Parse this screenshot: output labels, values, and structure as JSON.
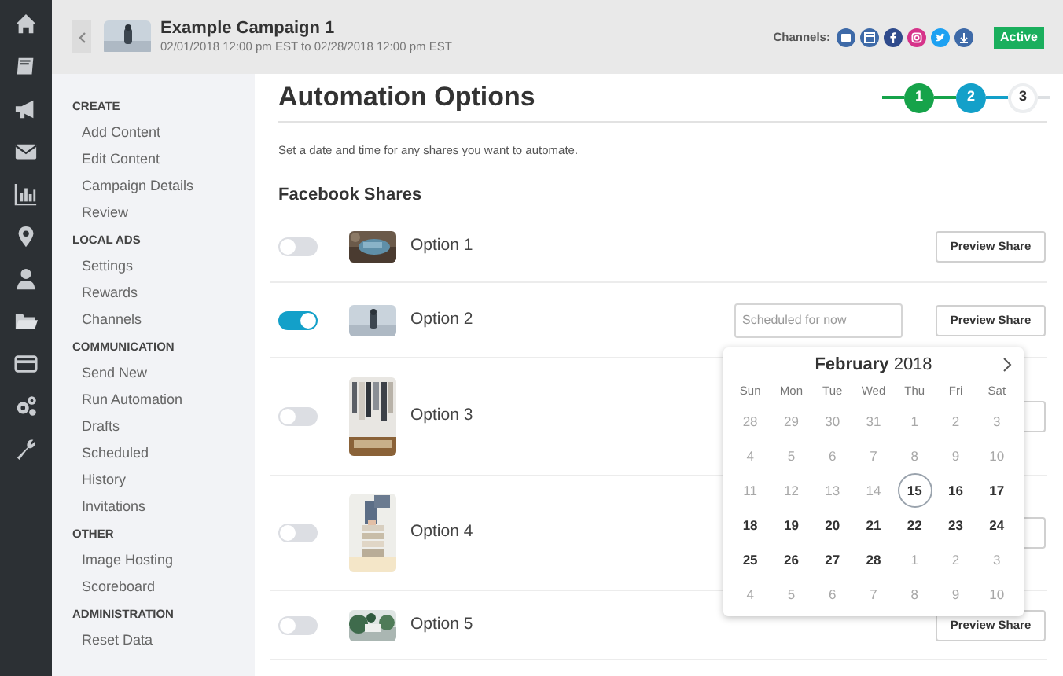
{
  "header": {
    "title": "Example Campaign 1",
    "dates": "02/01/2018 12:00 pm EST to 02/28/2018 12:00 pm EST",
    "channels_label": "Channels:",
    "status": "Active"
  },
  "sidebar": [
    {
      "heading": "CREATE",
      "items": [
        "Add Content",
        "Edit Content",
        "Campaign Details",
        "Review"
      ]
    },
    {
      "heading": "LOCAL ADS",
      "items": [
        "Settings",
        "Rewards",
        "Channels"
      ]
    },
    {
      "heading": "COMMUNICATION",
      "items": [
        "Send New",
        "Run Automation",
        "Drafts",
        "Scheduled",
        "History",
        "Invitations"
      ]
    },
    {
      "heading": "OTHER",
      "items": [
        "Image Hosting",
        "Scoreboard"
      ]
    },
    {
      "heading": "ADMINISTRATION",
      "items": [
        "Reset Data"
      ]
    }
  ],
  "page": {
    "title": "Automation Options",
    "description": "Set a date and time for any shares you want to automate.",
    "section": "Facebook Shares"
  },
  "stepper": [
    {
      "label": "1",
      "completed": true,
      "selected": false
    },
    {
      "label": "2",
      "completed": false,
      "selected": true
    },
    {
      "label": "3",
      "completed": false,
      "selected": false
    }
  ],
  "shares": [
    {
      "label": "Option 1",
      "on": false,
      "preview_button": "Preview Share"
    },
    {
      "label": "Option 2",
      "on": true,
      "schedule_field": {
        "placeholder": "Scheduled for now"
      },
      "preview_button": "Preview Share"
    },
    {
      "label": "Option 3",
      "on": false
    },
    {
      "label": "Option 4",
      "on": false
    },
    {
      "label": "Option 5",
      "on": false,
      "preview_button": "Preview Share"
    }
  ],
  "calendar": {
    "month": "February",
    "year": "2018",
    "weekdays": [
      "Sun",
      "Mon",
      "Tue",
      "Wed",
      "Thu",
      "Fri",
      "Sat"
    ],
    "weeks": [
      [
        {
          "label": "28",
          "disabled": true,
          "selected": false
        },
        {
          "label": "29",
          "disabled": true,
          "selected": false
        },
        {
          "label": "30",
          "disabled": true,
          "selected": false
        },
        {
          "label": "31",
          "disabled": true,
          "selected": false
        },
        {
          "label": "1",
          "disabled": true,
          "selected": false
        },
        {
          "label": "2",
          "disabled": true,
          "selected": false
        },
        {
          "label": "3",
          "disabled": true,
          "selected": false
        }
      ],
      [
        {
          "label": "4",
          "disabled": true,
          "selected": false
        },
        {
          "label": "5",
          "disabled": true,
          "selected": false
        },
        {
          "label": "6",
          "disabled": true,
          "selected": false
        },
        {
          "label": "7",
          "disabled": true,
          "selected": false
        },
        {
          "label": "8",
          "disabled": true,
          "selected": false
        },
        {
          "label": "9",
          "disabled": true,
          "selected": false
        },
        {
          "label": "10",
          "disabled": true,
          "selected": false
        }
      ],
      [
        {
          "label": "11",
          "disabled": true,
          "selected": false
        },
        {
          "label": "12",
          "disabled": true,
          "selected": false
        },
        {
          "label": "13",
          "disabled": true,
          "selected": false
        },
        {
          "label": "14",
          "disabled": true,
          "selected": false
        },
        {
          "label": "15",
          "disabled": false,
          "selected": true
        },
        {
          "label": "16",
          "disabled": false,
          "selected": false
        },
        {
          "label": "17",
          "disabled": false,
          "selected": false
        }
      ],
      [
        {
          "label": "18",
          "disabled": false,
          "selected": false
        },
        {
          "label": "19",
          "disabled": false,
          "selected": false
        },
        {
          "label": "20",
          "disabled": false,
          "selected": false
        },
        {
          "label": "21",
          "disabled": false,
          "selected": false
        },
        {
          "label": "22",
          "disabled": false,
          "selected": false
        },
        {
          "label": "23",
          "disabled": false,
          "selected": false
        },
        {
          "label": "24",
          "disabled": false,
          "selected": false
        }
      ],
      [
        {
          "label": "25",
          "disabled": false,
          "selected": false
        },
        {
          "label": "26",
          "disabled": false,
          "selected": false
        },
        {
          "label": "27",
          "disabled": false,
          "selected": false
        },
        {
          "label": "28",
          "disabled": false,
          "selected": false
        },
        {
          "label": "1",
          "disabled": true,
          "selected": false
        },
        {
          "label": "2",
          "disabled": true,
          "selected": false
        },
        {
          "label": "3",
          "disabled": true,
          "selected": false
        }
      ],
      [
        {
          "label": "4",
          "disabled": true,
          "selected": false
        },
        {
          "label": "5",
          "disabled": true,
          "selected": false
        },
        {
          "label": "6",
          "disabled": true,
          "selected": false
        },
        {
          "label": "7",
          "disabled": true,
          "selected": false
        },
        {
          "label": "8",
          "disabled": true,
          "selected": false
        },
        {
          "label": "9",
          "disabled": true,
          "selected": false
        },
        {
          "label": "10",
          "disabled": true,
          "selected": false
        }
      ]
    ]
  }
}
